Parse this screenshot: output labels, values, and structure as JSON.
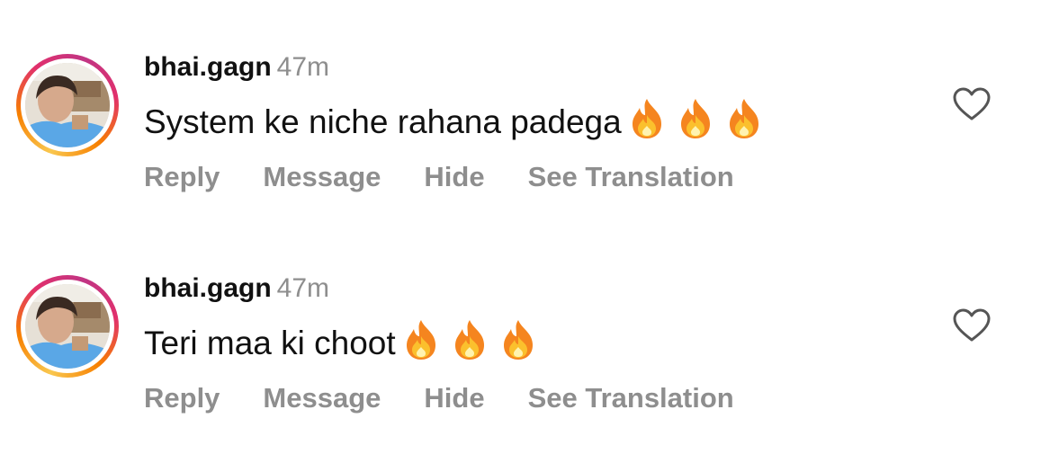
{
  "comments": [
    {
      "username": "bhai.gagn",
      "time": "47m",
      "text": "System ke niche rahana padega",
      "emoji_count": 3,
      "actions": {
        "reply": "Reply",
        "message": "Message",
        "hide": "Hide",
        "translate": "See Translation"
      }
    },
    {
      "username": "bhai.gagn",
      "time": "47m",
      "text": "Teri maa ki choot",
      "emoji_count": 3,
      "actions": {
        "reply": "Reply",
        "message": "Message",
        "hide": "Hide",
        "translate": "See Translation"
      }
    }
  ],
  "icons": {
    "emoji": "fire-emoji",
    "like": "heart-outline-icon"
  },
  "colors": {
    "username": "#111111",
    "secondary_text": "#8e8e8e",
    "story_ring_start": "#f9c74f",
    "story_ring_end": "#c13584"
  }
}
